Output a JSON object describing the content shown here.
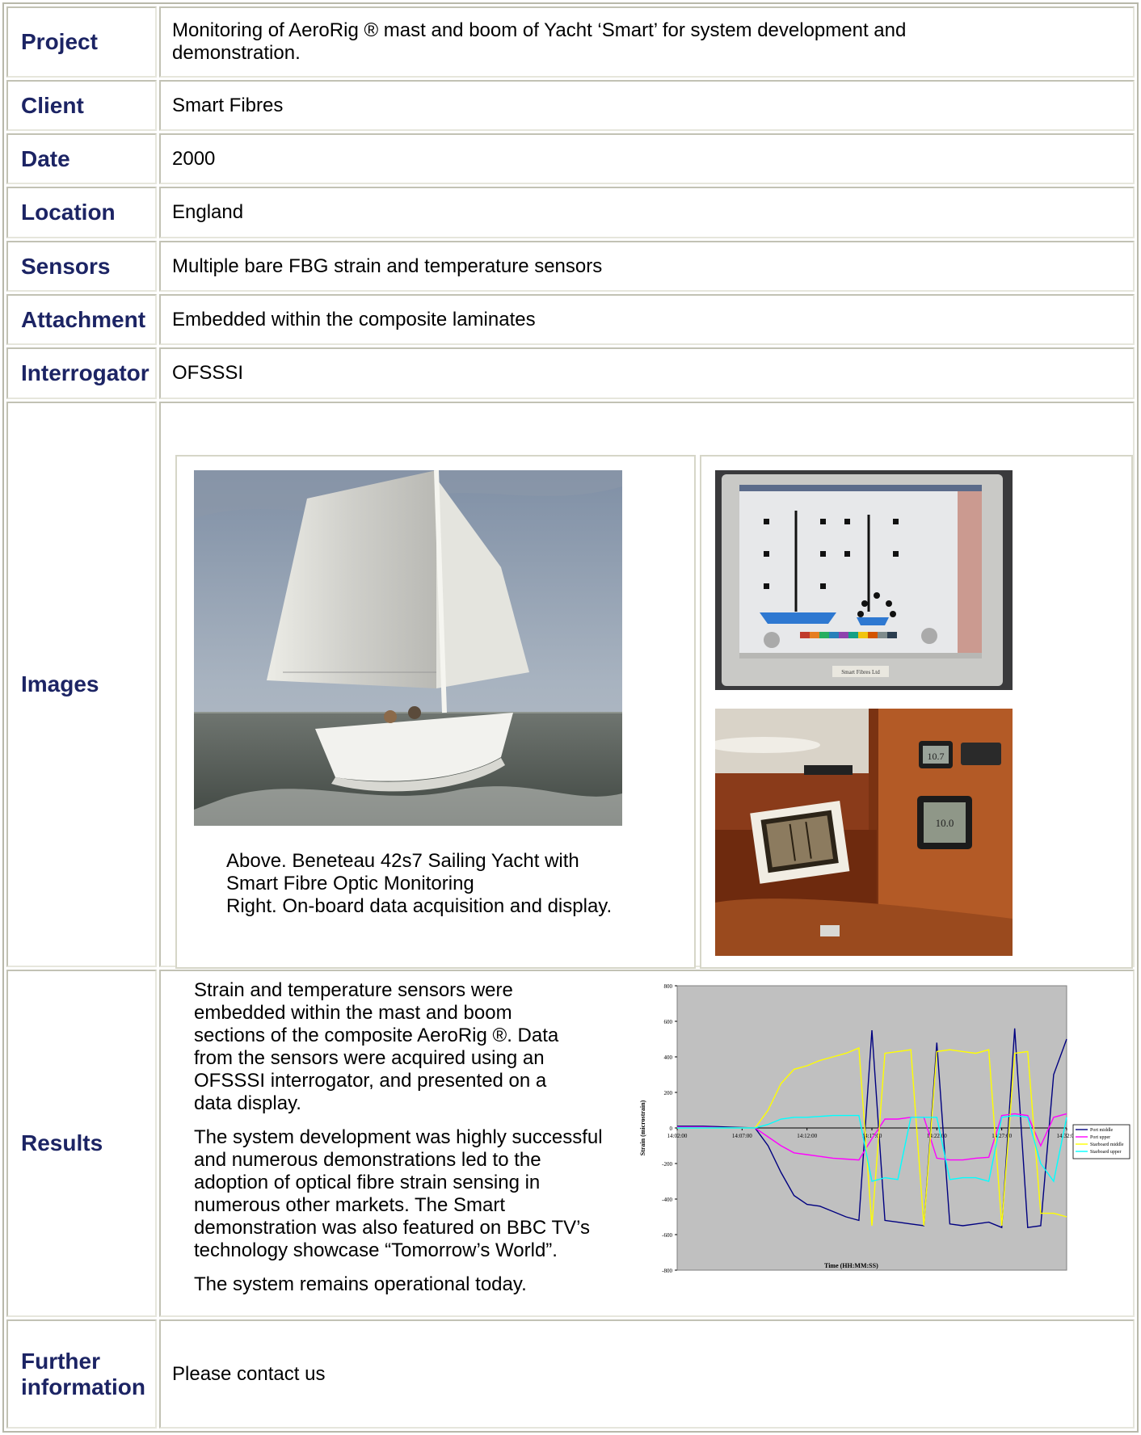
{
  "rows": {
    "project": {
      "label": "Project",
      "value": "Monitoring of AeroRig ® mast and boom of Yacht ‘Smart’ for system development and demonstration."
    },
    "client": {
      "label": "Client",
      "value": "Smart Fibres"
    },
    "date": {
      "label": "Date",
      "value": "2000"
    },
    "location": {
      "label": "Location",
      "value": "England"
    },
    "sensors": {
      "label": "Sensors",
      "value": "Multiple bare FBG strain and temperature sensors"
    },
    "attachment": {
      "label": "Attachment",
      "value": "Embedded within the composite laminates"
    },
    "interrogator": {
      "label": "Interrogator",
      "value": "OFSSSI"
    },
    "images": {
      "label": "Images",
      "caption_1": "Above. Beneteau 42s7 Sailing Yacht with",
      "caption_2": "Smart Fibre Optic Monitoring",
      "caption_3": "Right. On-board data acquisition and display.",
      "monitor_plate": "Smart Fibres Ltd",
      "instrument_reading_1": "10.7",
      "instrument_reading_2": "10.0"
    },
    "results": {
      "label": "Results",
      "para_1": "Strain and temperature sensors were embedded within the mast and boom sections of the composite AeroRig ®. Data from the sensors were acquired using an OFSSSI interrogator, and presented on a data display.",
      "para_2": "The system development was highly successful and numerous demonstrations led to the adoption of optical fibre strain sensing in numerous other markets. The Smart demonstration was also featured on BBC TV’s technology showcase “Tomorrow’s World”.",
      "para_3": "The system remains operational today."
    },
    "further": {
      "label_1": "Further",
      "label_2": "information",
      "value": "Please contact us"
    }
  },
  "colors": {
    "heading": "#1c2464",
    "border": "#c2c2b4",
    "chart_plot_bg": "#c0c0c0",
    "port_middle": "#000080",
    "port_upper": "#ff00ff",
    "starboard_middle": "#ffff00",
    "starboard_upper": "#00ffff"
  },
  "chart_data": {
    "type": "line",
    "xlabel": "Time (HH:MM:SS)",
    "ylabel": "Strain (microstrain)",
    "ylim": [
      -800,
      800
    ],
    "yticks": [
      "800",
      "600",
      "400",
      "200",
      "0",
      "-200",
      "-400",
      "-600",
      "-800"
    ],
    "xticks": [
      "14:02:00",
      "14:07:00",
      "14:12:00",
      "14:17:00",
      "14:22:00",
      "14:27:00",
      "14:32:00"
    ],
    "x": [
      "14:02:00",
      "14:04:00",
      "14:06:00",
      "14:08:00",
      "14:09:00",
      "14:10:00",
      "14:11:00",
      "14:12:00",
      "14:13:00",
      "14:14:00",
      "14:15:00",
      "14:16:00",
      "14:17:00",
      "14:18:00",
      "14:19:00",
      "14:20:00",
      "14:21:00",
      "14:22:00",
      "14:23:00",
      "14:24:00",
      "14:25:00",
      "14:26:00",
      "14:27:00",
      "14:28:00",
      "14:29:00",
      "14:30:00",
      "14:31:00",
      "14:32:00"
    ],
    "legend": "right",
    "grid": false,
    "series": [
      {
        "name": "Port middle",
        "values": [
          10,
          10,
          5,
          0,
          -100,
          -250,
          -380,
          -430,
          -440,
          -470,
          -500,
          -520,
          550,
          -520,
          -530,
          -540,
          -550,
          480,
          -540,
          -550,
          -540,
          -530,
          -560,
          560,
          -560,
          -550,
          300,
          500
        ]
      },
      {
        "name": "Port upper",
        "values": [
          5,
          5,
          0,
          0,
          -50,
          -100,
          -140,
          -150,
          -160,
          -170,
          -175,
          -180,
          -60,
          50,
          50,
          60,
          60,
          -170,
          -180,
          -180,
          -170,
          -165,
          70,
          80,
          70,
          -100,
          60,
          80
        ]
      },
      {
        "name": "Starboard middle",
        "values": [
          0,
          0,
          0,
          0,
          100,
          250,
          330,
          350,
          380,
          400,
          420,
          450,
          -550,
          420,
          430,
          440,
          -550,
          430,
          440,
          430,
          420,
          440,
          -550,
          420,
          430,
          -480,
          -480,
          -500
        ]
      },
      {
        "name": "Starboard upper",
        "values": [
          0,
          0,
          0,
          0,
          20,
          50,
          60,
          60,
          65,
          70,
          70,
          70,
          -300,
          -280,
          -290,
          60,
          60,
          60,
          -290,
          -280,
          -280,
          -300,
          60,
          70,
          60,
          -200,
          -300,
          60
        ]
      }
    ]
  }
}
